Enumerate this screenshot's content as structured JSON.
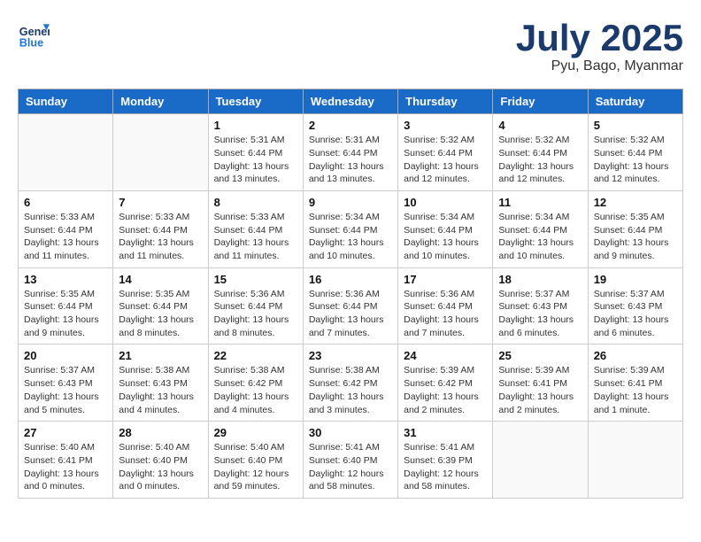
{
  "header": {
    "logo_general": "General",
    "logo_blue": "Blue",
    "month_title": "July 2025",
    "subtitle": "Pyu, Bago, Myanmar"
  },
  "weekdays": [
    "Sunday",
    "Monday",
    "Tuesday",
    "Wednesday",
    "Thursday",
    "Friday",
    "Saturday"
  ],
  "weeks": [
    [
      {
        "day": "",
        "info": ""
      },
      {
        "day": "",
        "info": ""
      },
      {
        "day": "1",
        "info": "Sunrise: 5:31 AM\nSunset: 6:44 PM\nDaylight: 13 hours\nand 13 minutes."
      },
      {
        "day": "2",
        "info": "Sunrise: 5:31 AM\nSunset: 6:44 PM\nDaylight: 13 hours\nand 13 minutes."
      },
      {
        "day": "3",
        "info": "Sunrise: 5:32 AM\nSunset: 6:44 PM\nDaylight: 13 hours\nand 12 minutes."
      },
      {
        "day": "4",
        "info": "Sunrise: 5:32 AM\nSunset: 6:44 PM\nDaylight: 13 hours\nand 12 minutes."
      },
      {
        "day": "5",
        "info": "Sunrise: 5:32 AM\nSunset: 6:44 PM\nDaylight: 13 hours\nand 12 minutes."
      }
    ],
    [
      {
        "day": "6",
        "info": "Sunrise: 5:33 AM\nSunset: 6:44 PM\nDaylight: 13 hours\nand 11 minutes."
      },
      {
        "day": "7",
        "info": "Sunrise: 5:33 AM\nSunset: 6:44 PM\nDaylight: 13 hours\nand 11 minutes."
      },
      {
        "day": "8",
        "info": "Sunrise: 5:33 AM\nSunset: 6:44 PM\nDaylight: 13 hours\nand 11 minutes."
      },
      {
        "day": "9",
        "info": "Sunrise: 5:34 AM\nSunset: 6:44 PM\nDaylight: 13 hours\nand 10 minutes."
      },
      {
        "day": "10",
        "info": "Sunrise: 5:34 AM\nSunset: 6:44 PM\nDaylight: 13 hours\nand 10 minutes."
      },
      {
        "day": "11",
        "info": "Sunrise: 5:34 AM\nSunset: 6:44 PM\nDaylight: 13 hours\nand 10 minutes."
      },
      {
        "day": "12",
        "info": "Sunrise: 5:35 AM\nSunset: 6:44 PM\nDaylight: 13 hours\nand 9 minutes."
      }
    ],
    [
      {
        "day": "13",
        "info": "Sunrise: 5:35 AM\nSunset: 6:44 PM\nDaylight: 13 hours\nand 9 minutes."
      },
      {
        "day": "14",
        "info": "Sunrise: 5:35 AM\nSunset: 6:44 PM\nDaylight: 13 hours\nand 8 minutes."
      },
      {
        "day": "15",
        "info": "Sunrise: 5:36 AM\nSunset: 6:44 PM\nDaylight: 13 hours\nand 8 minutes."
      },
      {
        "day": "16",
        "info": "Sunrise: 5:36 AM\nSunset: 6:44 PM\nDaylight: 13 hours\nand 7 minutes."
      },
      {
        "day": "17",
        "info": "Sunrise: 5:36 AM\nSunset: 6:44 PM\nDaylight: 13 hours\nand 7 minutes."
      },
      {
        "day": "18",
        "info": "Sunrise: 5:37 AM\nSunset: 6:43 PM\nDaylight: 13 hours\nand 6 minutes."
      },
      {
        "day": "19",
        "info": "Sunrise: 5:37 AM\nSunset: 6:43 PM\nDaylight: 13 hours\nand 6 minutes."
      }
    ],
    [
      {
        "day": "20",
        "info": "Sunrise: 5:37 AM\nSunset: 6:43 PM\nDaylight: 13 hours\nand 5 minutes."
      },
      {
        "day": "21",
        "info": "Sunrise: 5:38 AM\nSunset: 6:43 PM\nDaylight: 13 hours\nand 4 minutes."
      },
      {
        "day": "22",
        "info": "Sunrise: 5:38 AM\nSunset: 6:42 PM\nDaylight: 13 hours\nand 4 minutes."
      },
      {
        "day": "23",
        "info": "Sunrise: 5:38 AM\nSunset: 6:42 PM\nDaylight: 13 hours\nand 3 minutes."
      },
      {
        "day": "24",
        "info": "Sunrise: 5:39 AM\nSunset: 6:42 PM\nDaylight: 13 hours\nand 2 minutes."
      },
      {
        "day": "25",
        "info": "Sunrise: 5:39 AM\nSunset: 6:41 PM\nDaylight: 13 hours\nand 2 minutes."
      },
      {
        "day": "26",
        "info": "Sunrise: 5:39 AM\nSunset: 6:41 PM\nDaylight: 13 hours\nand 1 minute."
      }
    ],
    [
      {
        "day": "27",
        "info": "Sunrise: 5:40 AM\nSunset: 6:41 PM\nDaylight: 13 hours\nand 0 minutes."
      },
      {
        "day": "28",
        "info": "Sunrise: 5:40 AM\nSunset: 6:40 PM\nDaylight: 13 hours\nand 0 minutes."
      },
      {
        "day": "29",
        "info": "Sunrise: 5:40 AM\nSunset: 6:40 PM\nDaylight: 12 hours\nand 59 minutes."
      },
      {
        "day": "30",
        "info": "Sunrise: 5:41 AM\nSunset: 6:40 PM\nDaylight: 12 hours\nand 58 minutes."
      },
      {
        "day": "31",
        "info": "Sunrise: 5:41 AM\nSunset: 6:39 PM\nDaylight: 12 hours\nand 58 minutes."
      },
      {
        "day": "",
        "info": ""
      },
      {
        "day": "",
        "info": ""
      }
    ]
  ]
}
